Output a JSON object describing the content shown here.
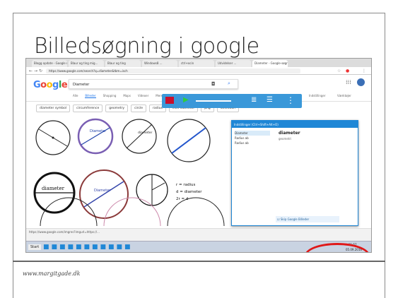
{
  "slide": {
    "title": "Billedsøgning i google",
    "footer": "www.margitgade.dk"
  },
  "browser": {
    "tabs": [
      "Blogg opdate - Google mail...",
      "Blaur og ting mig...",
      "Blaur og ting",
      "Windows8 ...",
      "ctrl+ocin",
      "Udvidelser ...",
      "Diameter - Google-søgning"
    ],
    "url": "https://www.google.com/search?q=diameter&tbm=isch"
  },
  "google": {
    "logo": [
      "G",
      "o",
      "o",
      "g",
      "l",
      "e"
    ],
    "query": "Diameter",
    "tabs": [
      "Alle",
      "Billeder",
      "Shopping",
      "Maps",
      "Videoer",
      "Mere"
    ],
    "active_tab": "Billeder",
    "right_links": [
      "Indstillinger",
      "Værktøjer"
    ],
    "chips": [
      "diameter symbol",
      "circumference",
      "geometry",
      "circle",
      "radius",
      "inch diameter",
      "png",
      "definition"
    ]
  },
  "images": {
    "circle_labels": [
      "Diameter",
      "diameter",
      "r = radius",
      "d = diameter",
      "2r = d",
      "Diameter"
    ]
  },
  "panel": {
    "header": "Indstillinger (Ctrl+Shift+Alt+O)",
    "heading": "diameter",
    "sub": "geometri",
    "items": [
      "Diameter",
      "Radius ab",
      "Radius ab"
    ],
    "highlight": "Skip Google Billeder"
  },
  "status": {
    "url": "https://www.google.com/imgres?imgurl=https://..."
  },
  "taskbar": {
    "start": "Start",
    "time": "11:57",
    "date": "05.09.2016"
  },
  "colors": {
    "accent": "#1f87d6",
    "highlight": "#e01818"
  }
}
